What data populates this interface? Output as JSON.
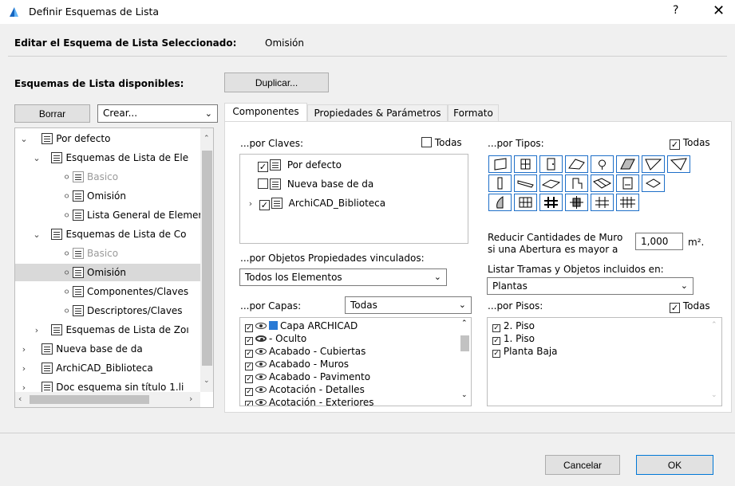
{
  "window": {
    "title": "Definir Esquemas de Lista",
    "help": "?",
    "close": "✕"
  },
  "header": {
    "label": "Editar el Esquema de Lista Seleccionado:",
    "value": "Omisión"
  },
  "left": {
    "heading": "Esquemas de Lista disponibles:",
    "borrar": "Borrar",
    "crear": "Crear...",
    "tree": [
      "Por defecto",
      "Esquemas de Lista de Ele",
      "Basico",
      "Omisión",
      "Lista General de Elemer",
      "Esquemas de Lista de Co",
      "Basico",
      "Omisión",
      "Componentes/Claves",
      "Descriptores/Claves",
      "Esquemas de Lista de Zoı",
      "Nueva base de da",
      "ArchiCAD_Biblioteca",
      "Doc esquema sin título 1.li"
    ]
  },
  "duplicar": "Duplicar...",
  "tabs": [
    "Componentes",
    "Propiedades & Parámetros",
    "Formato"
  ],
  "claves": {
    "label": "...por Claves:",
    "todas": "Todas",
    "items": [
      "Por defecto",
      "Nueva base de da",
      "ArchiCAD_Biblioteca"
    ]
  },
  "tipos": {
    "label": "...por Tipos:",
    "todas": "Todas"
  },
  "reducir": {
    "line1": "Reducir Cantidades de Muro",
    "line2": "si una Abertura es mayor a",
    "value": "1,000",
    "unit": "m²."
  },
  "objetos": {
    "label": "...por Objetos Propiedades vinculados:",
    "value": "Todos los Elementos"
  },
  "listar": {
    "label": "Listar Tramas y Objetos incluidos en:",
    "value": "Plantas"
  },
  "capas": {
    "label": "...por Capas:",
    "value": "Todas",
    "items": [
      "Capa ARCHICAD",
      "- Oculto",
      "Acabado - Cubiertas",
      "Acabado - Muros",
      "Acabado - Pavimento",
      "Acotación - Detalles",
      "Acotación - Exteriores"
    ]
  },
  "pisos": {
    "label": "...por Pisos:",
    "todas": "Todas",
    "items": [
      "2. Piso",
      "1. Piso",
      "Planta Baja"
    ]
  },
  "footer": {
    "cancel": "Cancelar",
    "ok": "OK"
  }
}
